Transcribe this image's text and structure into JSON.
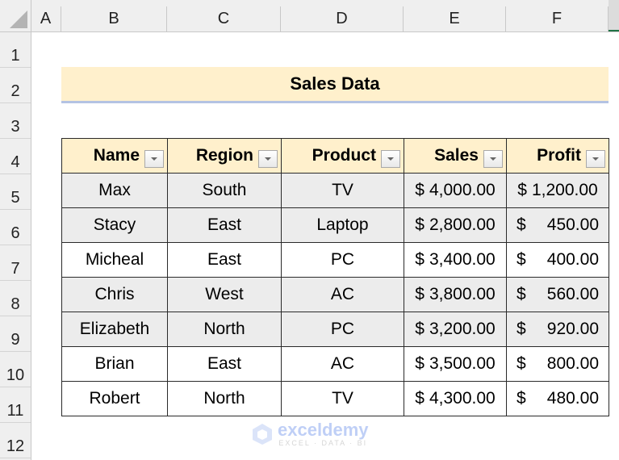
{
  "sheet": {
    "column_headers": [
      "A",
      "B",
      "C",
      "D",
      "E",
      "F"
    ],
    "row_headers": [
      "1",
      "2",
      "3",
      "4",
      "5",
      "6",
      "7",
      "8",
      "9",
      "10",
      "11",
      "12"
    ]
  },
  "title": "Sales Data",
  "table": {
    "columns": [
      "Name",
      "Region",
      "Product",
      "Sales",
      "Profit"
    ],
    "rows": [
      {
        "name": "Max",
        "region": "South",
        "product": "TV",
        "sales_sym": "$",
        "sales": "4,000.00",
        "profit_sym": "$",
        "profit": "1,200.00",
        "highlighted": true
      },
      {
        "name": "Stacy",
        "region": "East",
        "product": "Laptop",
        "sales_sym": "$",
        "sales": "2,800.00",
        "profit_sym": "$",
        "profit": "450.00",
        "highlighted": true
      },
      {
        "name": "Micheal",
        "region": "East",
        "product": "PC",
        "sales_sym": "$",
        "sales": "3,400.00",
        "profit_sym": "$",
        "profit": "400.00",
        "highlighted": false
      },
      {
        "name": "Chris",
        "region": "West",
        "product": "AC",
        "sales_sym": "$",
        "sales": "3,800.00",
        "profit_sym": "$",
        "profit": "560.00",
        "highlighted": true
      },
      {
        "name": "Elizabeth",
        "region": "North",
        "product": "PC",
        "sales_sym": "$",
        "sales": "3,200.00",
        "profit_sym": "$",
        "profit": "920.00",
        "highlighted": true
      },
      {
        "name": "Brian",
        "region": "East",
        "product": "AC",
        "sales_sym": "$",
        "sales": "3,500.00",
        "profit_sym": "$",
        "profit": "800.00",
        "highlighted": false
      },
      {
        "name": "Robert",
        "region": "North",
        "product": "TV",
        "sales_sym": "$",
        "sales": "4,300.00",
        "profit_sym": "$",
        "profit": "480.00",
        "highlighted": false
      }
    ]
  },
  "watermark": {
    "main": "exceldemy",
    "sub": "EXCEL · DATA · BI"
  },
  "colors": {
    "header_fill": "#fff0cc",
    "highlight_fill": "#ececec",
    "title_underline": "#b4c3e3"
  }
}
